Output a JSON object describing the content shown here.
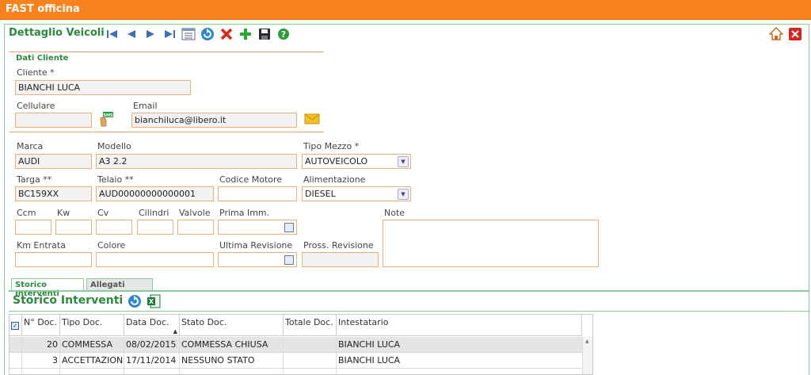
{
  "app": {
    "title": "FAST officina"
  },
  "panel": {
    "title": "Dettaglio Veicoli"
  },
  "toolbar": {
    "icons": [
      "first-icon",
      "prev-icon",
      "next-icon",
      "last-icon",
      "list-icon",
      "refresh-icon",
      "delete-icon",
      "add-icon",
      "save-icon",
      "help-icon"
    ],
    "right_icons": [
      "home-icon",
      "close-icon"
    ]
  },
  "cliente": {
    "section": "Dati Cliente",
    "cliente_label": "Cliente *",
    "cliente_value": "BIANCHI LUCA",
    "cellulare_label": "Cellulare",
    "cellulare_value": "",
    "email_label": "Email",
    "email_value": "bianchiluca@libero.it"
  },
  "veicolo": {
    "marca_label": "Marca",
    "marca_value": "AUDI",
    "modello_label": "Modello",
    "modello_value": "A3 2.2",
    "tipo_mezzo_label": "Tipo Mezzo *",
    "tipo_mezzo_value": "AUTOVEICOLO",
    "targa_label": "Targa **",
    "targa_value": "BC159XX",
    "telaio_label": "Telaio **",
    "telaio_value": "AUD00000000000001",
    "codice_motore_label": "Codice Motore",
    "codice_motore_value": "",
    "alimentazione_label": "Alimentazione",
    "alimentazione_value": "DIESEL",
    "ccm_label": "Ccm",
    "kw_label": "Kw",
    "cv_label": "Cv",
    "cilindri_label": "Cilindri",
    "valvole_label": "Valvole",
    "prima_imm_label": "Prima Imm.",
    "note_label": "Note",
    "km_entrata_label": "Km Entrata",
    "colore_label": "Colore",
    "ultima_revisione_label": "Ultima Revisione",
    "pross_revisione_label": "Pross. Revisione"
  },
  "tabs": [
    {
      "label": "Storico Interventi",
      "active": true
    },
    {
      "label": "Allegati",
      "active": false
    }
  ],
  "storico": {
    "title": "Storico Interventi",
    "columns": [
      "N° Doc.",
      "Tipo Doc.",
      "Data Doc.",
      "Stato Doc.",
      "Totale Doc.",
      "Intestatario"
    ],
    "rows": [
      {
        "n": "20",
        "tipo": "COMMESSA",
        "data": "08/02/2015",
        "stato": "COMMESSA CHIUSA",
        "totale": "",
        "intestatario": "BIANCHI LUCA"
      },
      {
        "n": "3",
        "tipo": "ACCETTAZION",
        "data": "17/11/2014",
        "stato": "NESSUNO STATO",
        "totale": "",
        "intestatario": "BIANCHI LUCA"
      }
    ]
  },
  "colors": {
    "header": "#f7821e",
    "accent_green": "#2a8a3e",
    "field_border": "#e6b07c"
  }
}
